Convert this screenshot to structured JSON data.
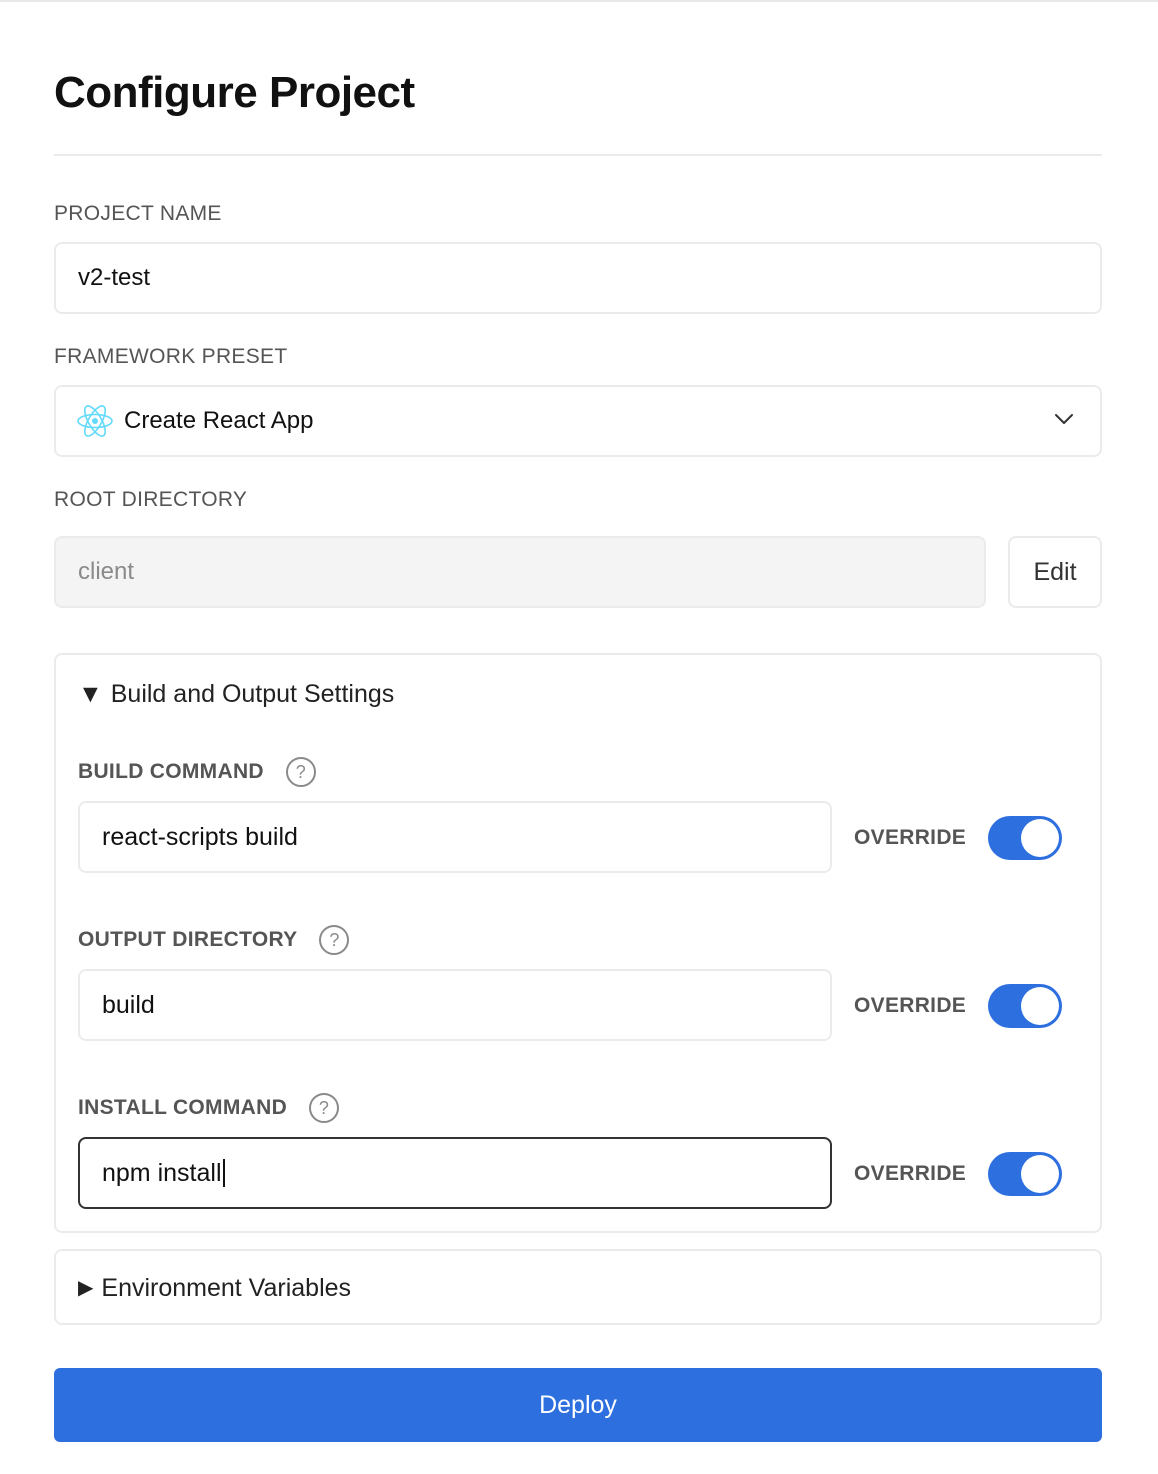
{
  "page": {
    "title": "Configure Project"
  },
  "project_name": {
    "label": "PROJECT NAME",
    "value": "v2-test"
  },
  "framework_preset": {
    "label": "FRAMEWORK PRESET",
    "selected": "Create React App",
    "icon": "react-icon"
  },
  "root_directory": {
    "label": "ROOT DIRECTORY",
    "value": "client",
    "edit_label": "Edit"
  },
  "build_settings": {
    "summary": "Build and Output Settings",
    "expanded": true,
    "fields": [
      {
        "label": "BUILD COMMAND",
        "value": "react-scripts build",
        "override_label": "OVERRIDE",
        "override_on": true
      },
      {
        "label": "OUTPUT DIRECTORY",
        "value": "build",
        "override_label": "OVERRIDE",
        "override_on": true
      },
      {
        "label": "INSTALL COMMAND",
        "value": "npm install",
        "override_label": "OVERRIDE",
        "override_on": true
      }
    ]
  },
  "environment_variables": {
    "summary": "Environment Variables",
    "expanded": false
  },
  "deploy": {
    "label": "Deploy"
  },
  "colors": {
    "accent": "#2e6fe0",
    "border": "#ebebeb",
    "label": "#555555"
  }
}
